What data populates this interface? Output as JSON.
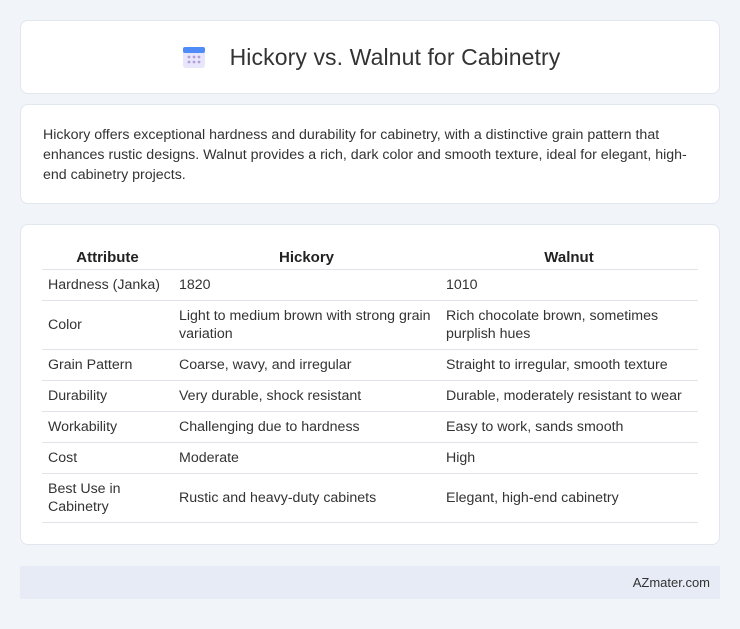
{
  "header": {
    "title": "Hickory vs. Walnut for Cabinetry",
    "icon": "calendar-icon",
    "icon_colors": {
      "top": "#4f8cf7",
      "body": "#e8e6fb",
      "dots": "#b39ddb"
    }
  },
  "intro": {
    "text": "Hickory offers exceptional hardness and durability for cabinetry, with a distinctive grain pattern that enhances rustic designs. Walnut provides a rich, dark color and smooth texture, ideal for elegant, high-end cabinetry projects."
  },
  "table": {
    "headers": [
      "Attribute",
      "Hickory",
      "Walnut"
    ],
    "rows": [
      [
        "Hardness (Janka)",
        "1820",
        "1010"
      ],
      [
        "Color",
        "Light to medium brown with strong grain variation",
        "Rich chocolate brown, sometimes purplish hues"
      ],
      [
        "Grain Pattern",
        "Coarse, wavy, and irregular",
        "Straight to irregular, smooth texture"
      ],
      [
        "Durability",
        "Very durable, shock resistant",
        "Durable, moderately resistant to wear"
      ],
      [
        "Workability",
        "Challenging due to hardness",
        "Easy to work, sands smooth"
      ],
      [
        "Cost",
        "Moderate",
        "High"
      ],
      [
        "Best Use in Cabinetry",
        "Rustic and heavy-duty cabinets",
        "Elegant, high-end cabinetry"
      ]
    ]
  },
  "footer": {
    "source": "AZmater.com"
  }
}
